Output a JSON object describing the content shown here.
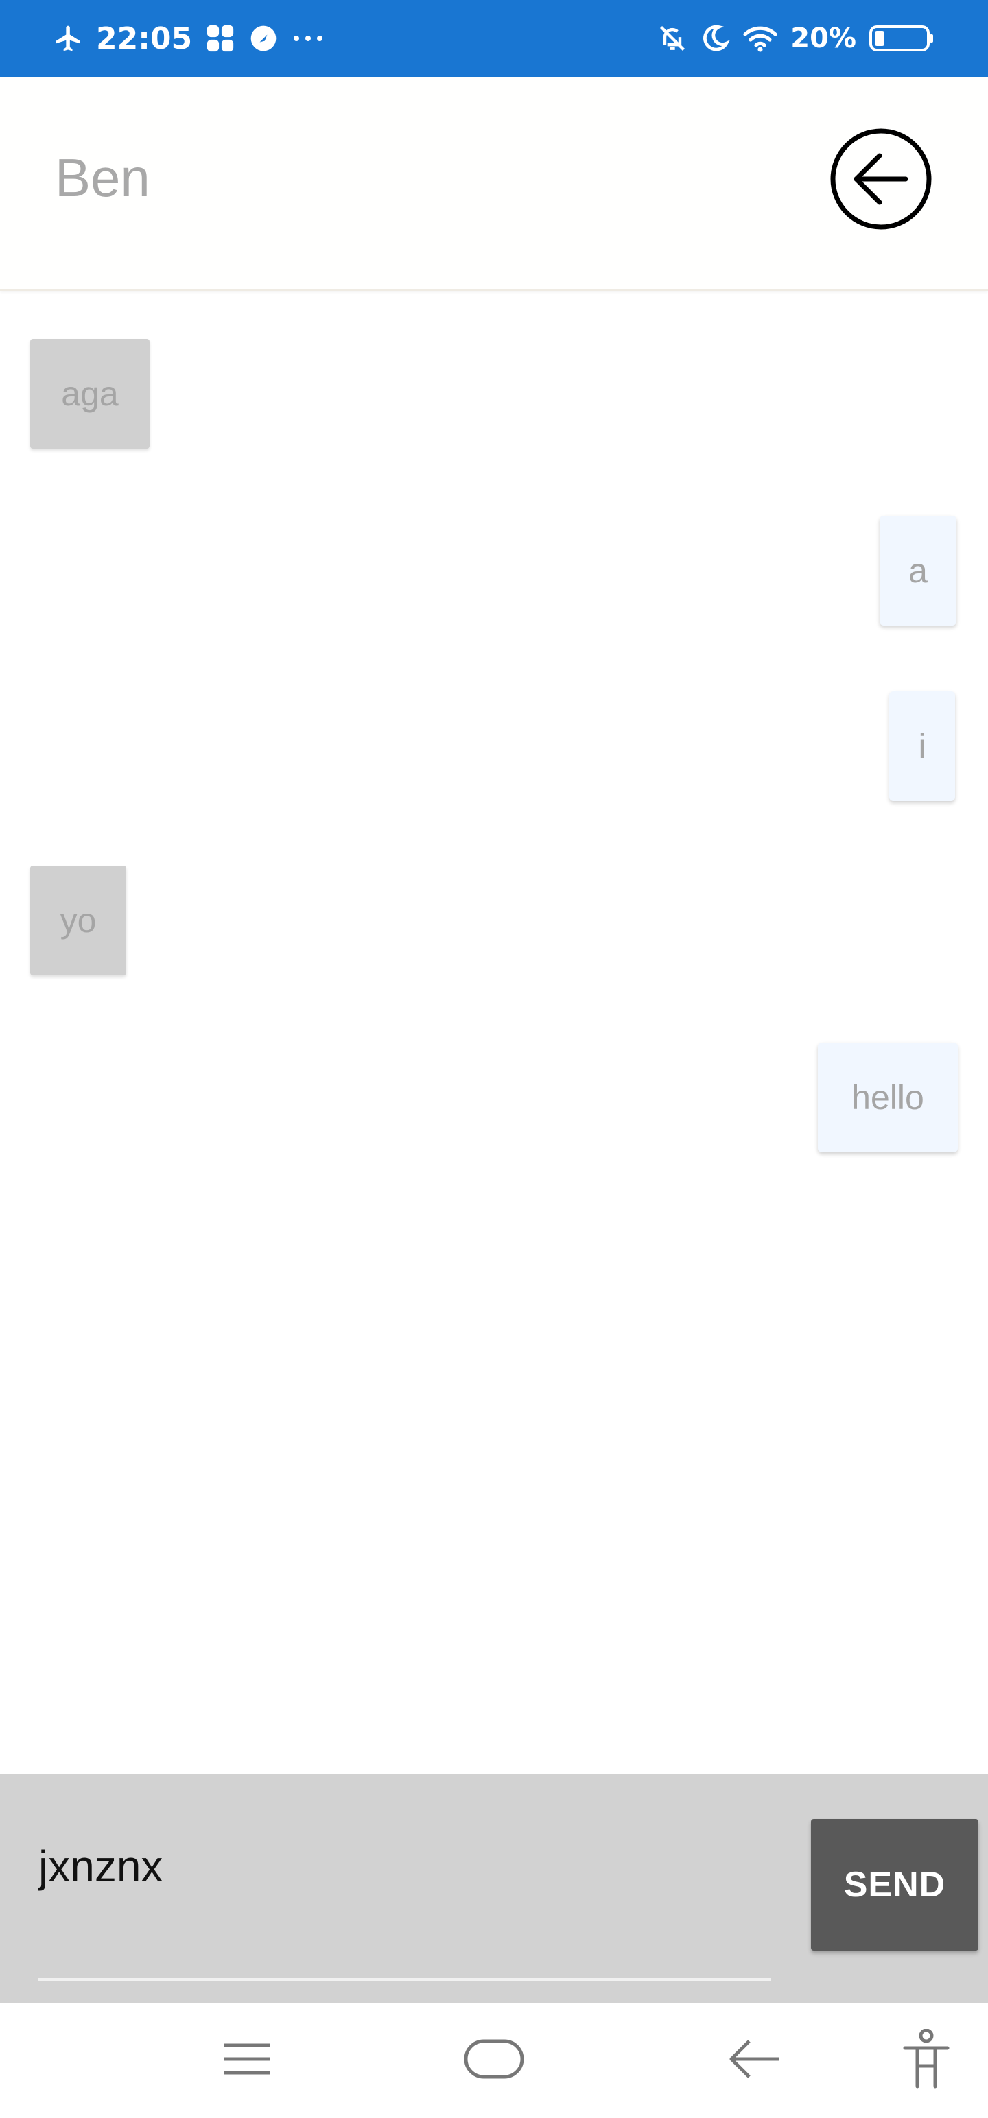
{
  "status_bar": {
    "time": "22:05",
    "battery": "20%",
    "icons_left": [
      "airplane-mode-icon",
      "app-notification-icon",
      "pinwheel-icon",
      "more-dots-icon"
    ],
    "icons_right": [
      "bell-off-icon",
      "moon-icon",
      "wifi-icon",
      "battery-icon"
    ],
    "background_color": "#1976d2"
  },
  "header": {
    "title": "Ben",
    "back_icon": "arrow-left-circle-icon"
  },
  "messages": [
    {
      "text": "aga",
      "direction": "incoming"
    },
    {
      "text": "a",
      "direction": "outgoing"
    },
    {
      "text": "i",
      "direction": "outgoing"
    },
    {
      "text": "yo",
      "direction": "incoming"
    },
    {
      "text": "hello",
      "direction": "outgoing"
    }
  ],
  "composer": {
    "input_value": "jxnznx",
    "send_label": "SEND"
  },
  "nav_bar": {
    "icons": [
      "menu-icon",
      "home-icon",
      "back-arrow-icon",
      "accessibility-icon"
    ]
  },
  "colors": {
    "incoming_bubble": "#d0d0d0",
    "outgoing_bubble": "#f1f7ff",
    "composer_bg": "#d2d2d2",
    "send_button": "#595959"
  }
}
